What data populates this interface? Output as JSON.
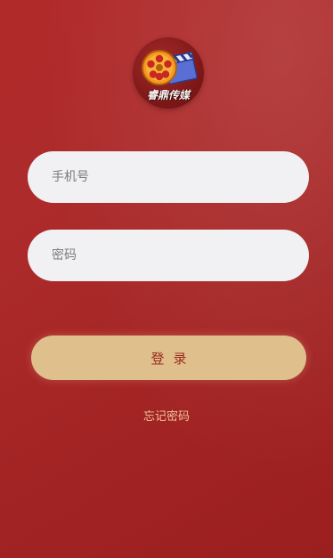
{
  "logo": {
    "text": "睿鼎传媒",
    "icon": "film-reel-clapperboard-icon"
  },
  "form": {
    "phone_placeholder": "手机号",
    "password_placeholder": "密码",
    "login_label": "登录",
    "forgot_label": "忘记密码"
  },
  "colors": {
    "background": "#a82626",
    "input_bg": "#f1f1f3",
    "button_bg": "#dfc08c",
    "button_text": "#9a2a22",
    "link_text": "#f0c39a"
  }
}
